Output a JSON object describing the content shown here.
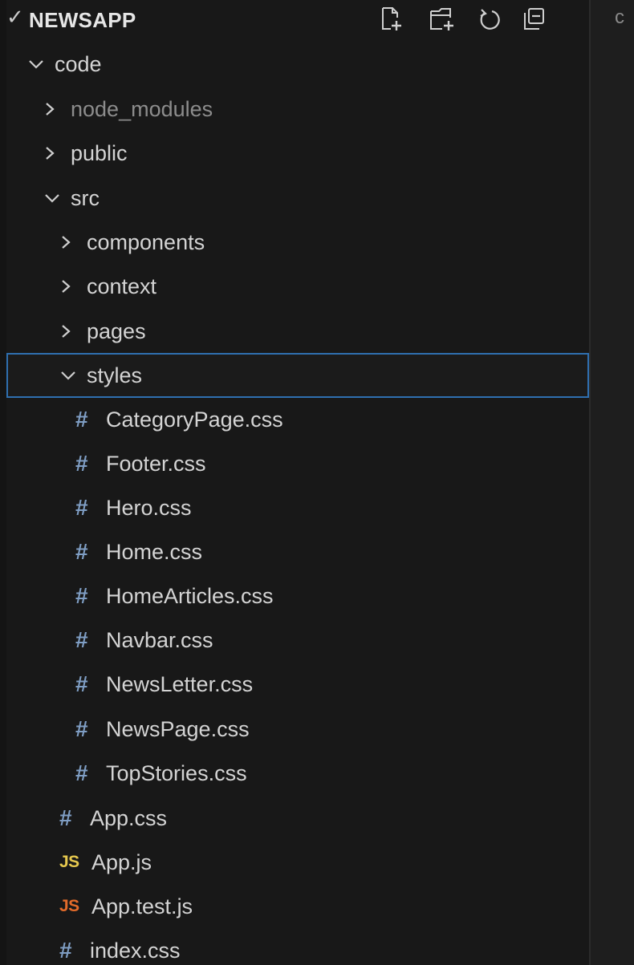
{
  "explorer": {
    "title": "NEWSAPP",
    "header_buttons": [
      {
        "name": "new-file-icon"
      },
      {
        "name": "new-folder-icon"
      },
      {
        "name": "refresh-icon"
      },
      {
        "name": "collapse-all-icon"
      }
    ],
    "tree": [
      {
        "label": "code",
        "type": "folder",
        "expanded": true
      },
      {
        "label": "node_modules",
        "type": "folder",
        "expanded": false,
        "dimmed": true
      },
      {
        "label": "public",
        "type": "folder",
        "expanded": false
      },
      {
        "label": "src",
        "type": "folder",
        "expanded": true
      },
      {
        "label": "components",
        "type": "folder",
        "expanded": false
      },
      {
        "label": "context",
        "type": "folder",
        "expanded": false
      },
      {
        "label": "pages",
        "type": "folder",
        "expanded": false
      },
      {
        "label": "styles",
        "type": "folder",
        "expanded": true,
        "selected": true
      },
      {
        "label": "CategoryPage.css",
        "type": "css"
      },
      {
        "label": "Footer.css",
        "type": "css"
      },
      {
        "label": "Hero.css",
        "type": "css"
      },
      {
        "label": "Home.css",
        "type": "css"
      },
      {
        "label": "HomeArticles.css",
        "type": "css"
      },
      {
        "label": "Navbar.css",
        "type": "css"
      },
      {
        "label": "NewsLetter.css",
        "type": "css"
      },
      {
        "label": "NewsPage.css",
        "type": "css"
      },
      {
        "label": "TopStories.css",
        "type": "css"
      },
      {
        "label": "App.css",
        "type": "css"
      },
      {
        "label": "App.js",
        "type": "js"
      },
      {
        "label": "App.test.js",
        "type": "js-test"
      },
      {
        "label": "index.css",
        "type": "css"
      }
    ],
    "icon_glyphs": {
      "css": "#",
      "js": "JS"
    }
  },
  "editor": {
    "peek_text": "c"
  },
  "colors": {
    "sidebar_bg": "#181818",
    "text": "#d4d4d4",
    "css_icon": "#7f9ec4",
    "js_icon": "#e6c84e",
    "test_icon": "#e36b2a",
    "selection_border": "#2f6fb0"
  }
}
